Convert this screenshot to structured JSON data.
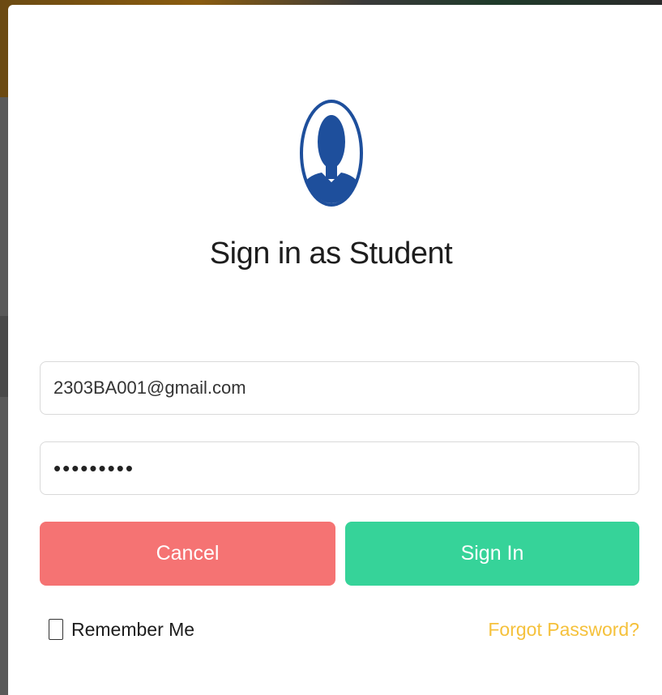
{
  "dialog": {
    "title": "Sign in as Student"
  },
  "form": {
    "email_value": "2303BA001@gmail.com",
    "password_value": "•••••••••"
  },
  "actions": {
    "cancel_label": "Cancel",
    "signin_label": "Sign In"
  },
  "options": {
    "remember_label": "Remember Me",
    "remember_checked": false,
    "forgot_label": "Forgot Password?"
  },
  "icons": {
    "avatar": "user-avatar-icon"
  },
  "colors": {
    "avatar_blue": "#1e4f9c",
    "cancel": "#f57373",
    "signin": "#36d399",
    "forgot_link": "#f5c13b"
  }
}
